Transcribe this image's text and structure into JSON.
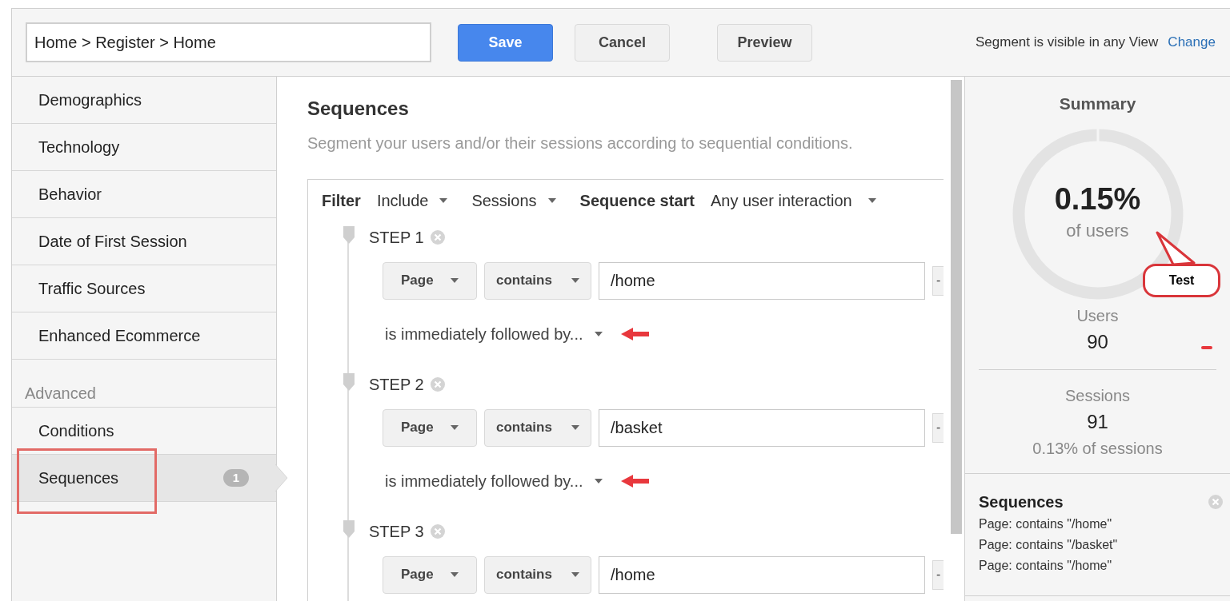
{
  "toolbar": {
    "segment_name": "Home > Register > Home",
    "buttons": [
      {
        "label": "Save",
        "kind": "primary"
      },
      {
        "label": "Cancel",
        "kind": "secondary"
      },
      {
        "label": "Preview",
        "kind": "secondary"
      }
    ],
    "visibility_text": "Segment is visible in any View",
    "visibility_link": "Change"
  },
  "sidebar": {
    "items": [
      {
        "label": "Demographics",
        "selected": false,
        "highlighted": false
      },
      {
        "label": "Technology",
        "selected": false,
        "highlighted": false
      },
      {
        "label": "Behavior",
        "selected": false,
        "highlighted": false
      },
      {
        "label": "Date of First Session",
        "selected": false,
        "highlighted": false
      },
      {
        "label": "Traffic Sources",
        "selected": false,
        "highlighted": false
      },
      {
        "label": "Enhanced Ecommerce",
        "selected": false,
        "highlighted": false
      }
    ],
    "advanced_heading": "Advanced",
    "advanced_items": [
      {
        "label": "Conditions",
        "selected": false,
        "highlighted": false
      },
      {
        "label": "Sequences",
        "selected": true,
        "highlighted": true,
        "badge": "1"
      }
    ]
  },
  "main": {
    "title": "Sequences",
    "subtitle": "Segment your users and/or their sessions according to sequential conditions.",
    "filter": {
      "label": "Filter",
      "include": "Include",
      "scope": "Sessions",
      "start_label": "Sequence start",
      "start_value": "Any user interaction"
    },
    "steps": [
      {
        "label": "STEP 1",
        "dimension": "Page",
        "operator": "contains",
        "value": "/home",
        "side_button": "-",
        "followed_by": "is immediately followed by...",
        "arrow_marked": true
      },
      {
        "label": "STEP 2",
        "dimension": "Page",
        "operator": "contains",
        "value": "/basket",
        "side_button": "-",
        "followed_by": "is immediately followed by...",
        "arrow_marked": true
      },
      {
        "label": "STEP 3",
        "dimension": "Page",
        "operator": "contains",
        "value": "/home",
        "side_button": "-"
      }
    ]
  },
  "summary": {
    "title": "Summary",
    "percent": "0.15%",
    "percent_label": "of users",
    "callout": "Test",
    "users_label": "Users",
    "users_value": "90",
    "sessions_label": "Sessions",
    "sessions_value": "91",
    "sessions_share": "0.13% of sessions",
    "sequences_title": "Sequences",
    "sequences_lines": [
      "Page: contains \"/home\"",
      "Page: contains \"/basket\"",
      "Page: contains \"/home\""
    ]
  }
}
